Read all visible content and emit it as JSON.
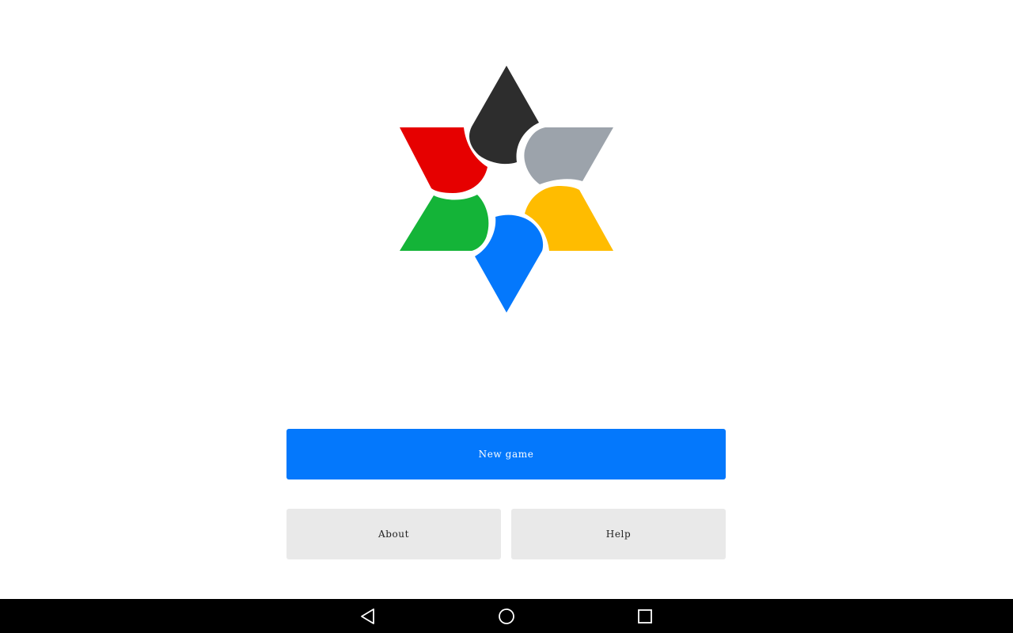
{
  "app": {
    "logo_colors": {
      "top": "#2d2d2d",
      "upper_right": "#9ca3ab",
      "lower_right": "#ffbc00",
      "bottom": "#0478fc",
      "lower_left": "#14b438",
      "upper_left": "#e60000"
    }
  },
  "menu": {
    "new_game_label": "New game",
    "about_label": "About",
    "help_label": "Help"
  },
  "navbar": {
    "back_icon": "back-triangle-icon",
    "home_icon": "home-circle-icon",
    "recents_icon": "recents-square-icon"
  }
}
